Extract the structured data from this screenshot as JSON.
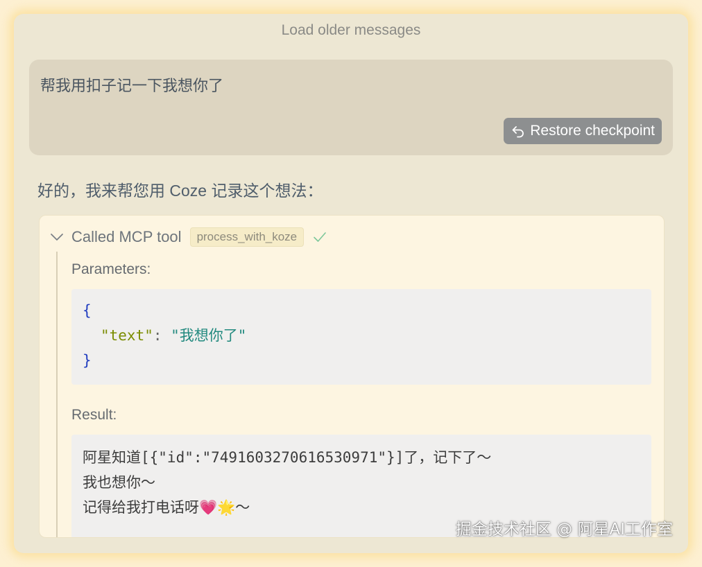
{
  "chat": {
    "load_older": "Load older messages",
    "user_message": "帮我用扣子记一下我想你了",
    "restore_label": "Restore checkpoint",
    "assistant_message": "好的，我来帮您用 Coze 记录这个想法："
  },
  "tool_call": {
    "title": "Called MCP tool",
    "tool_name": "process_with_koze",
    "status_icon": "check-icon",
    "parameters_label": "Parameters:",
    "parameters": {
      "open_brace": "{",
      "key": "\"text\"",
      "colon": ": ",
      "value": "\"我想你了\"",
      "close_brace": "}"
    },
    "result_label": "Result:",
    "result_lines": [
      "阿星知道[{\"id\":\"7491603270616530971\"}]了，记下了～",
      "我也想你～",
      "记得给我打电话呀💗🌟～"
    ]
  },
  "watermark": "掘金技术社区 @ 阿星AI工作室",
  "colors": {
    "panel_bg": "#ede7d3",
    "user_bubble": "#ddd5c1",
    "restore_button": "#8d8f90",
    "tool_card_bg": "#fdf5e1",
    "code_bg": "#f0efee",
    "json_brace": "#1f3bbf",
    "json_key": "#7a8c00",
    "json_string": "#21897e",
    "check_green": "#7cc79a"
  }
}
